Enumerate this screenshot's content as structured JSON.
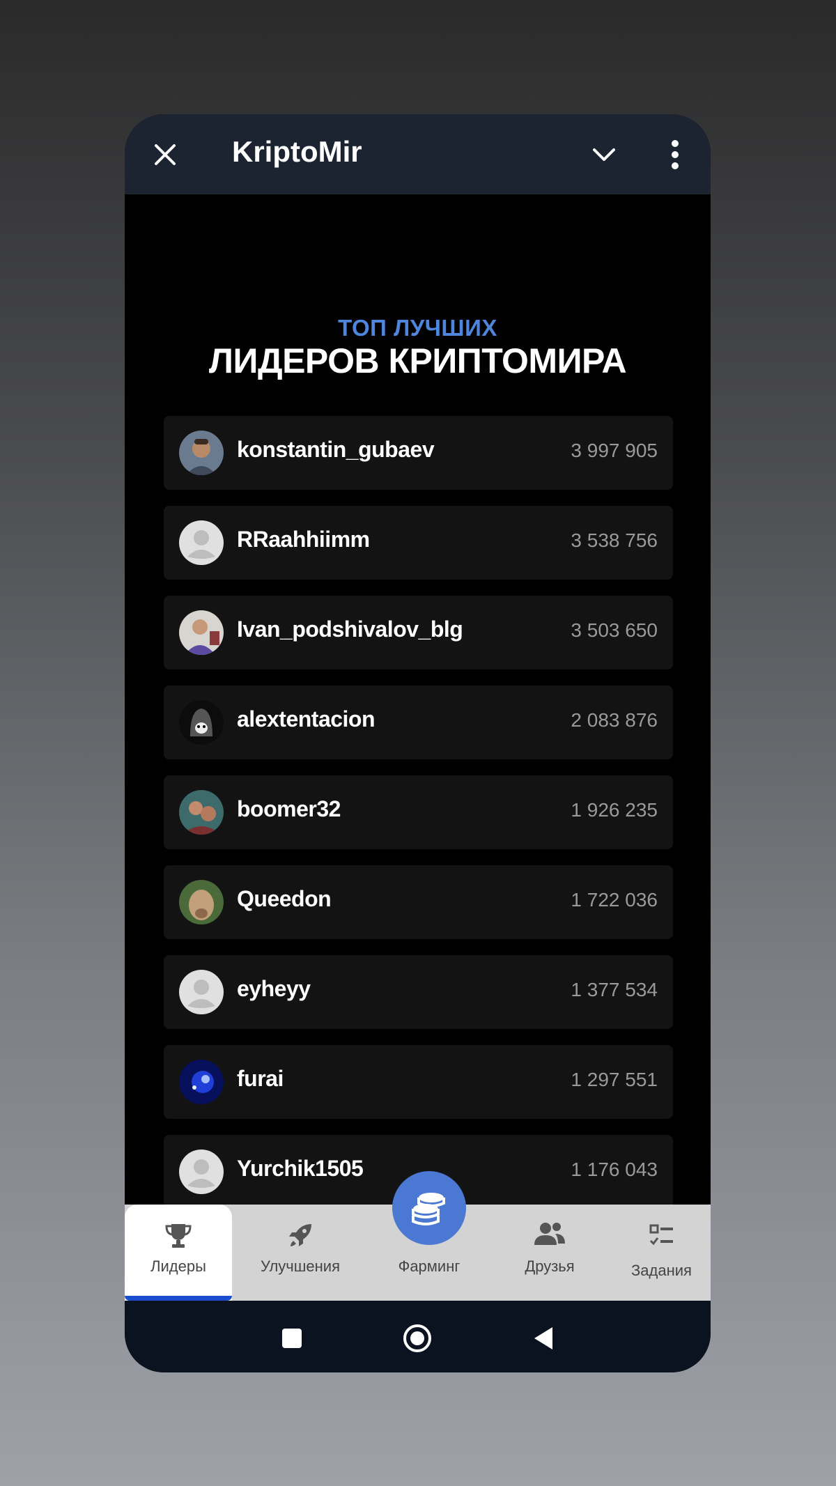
{
  "app": {
    "title": "KriptoMir"
  },
  "header": {
    "subtitle": "ТОП ЛУЧШИХ",
    "title": "ЛИДЕРОВ КРИПТОМИРА"
  },
  "leaders": [
    {
      "name": "konstantin_gubaev",
      "score": "3 997 905",
      "avatar": "photo"
    },
    {
      "name": "RRaahhiimm",
      "score": "3 538 756",
      "avatar": "default"
    },
    {
      "name": "Ivan_podshivalov_blg",
      "score": "3 503 650",
      "avatar": "photo"
    },
    {
      "name": "alextentacion",
      "score": "2 083 876",
      "avatar": "photo"
    },
    {
      "name": "boomer32",
      "score": "1 926 235",
      "avatar": "photo"
    },
    {
      "name": "Queedon",
      "score": "1 722 036",
      "avatar": "photo"
    },
    {
      "name": "eyheyy",
      "score": "1 377 534",
      "avatar": "default"
    },
    {
      "name": "furai",
      "score": "1 297 551",
      "avatar": "photo"
    },
    {
      "name": "Yurchik1505",
      "score": "1 176 043",
      "avatar": "default"
    }
  ],
  "tabs": {
    "leaders": "Лидеры",
    "upgrades": "Улучшения",
    "farming": "Фарминг",
    "friends": "Друзья",
    "tasks": "Задания"
  },
  "icons": {
    "close": "close-icon",
    "chevron": "chevron-down-icon",
    "more": "more-vertical-icon",
    "leaders": "trophy-icon",
    "upgrades": "rocket-icon",
    "farming": "coins-icon",
    "friends": "people-icon",
    "tasks": "checklist-icon"
  },
  "colors": {
    "accent": "#4a78d2",
    "subtitle": "#4f86dd",
    "active_tab_indicator": "#1a4ecf"
  }
}
